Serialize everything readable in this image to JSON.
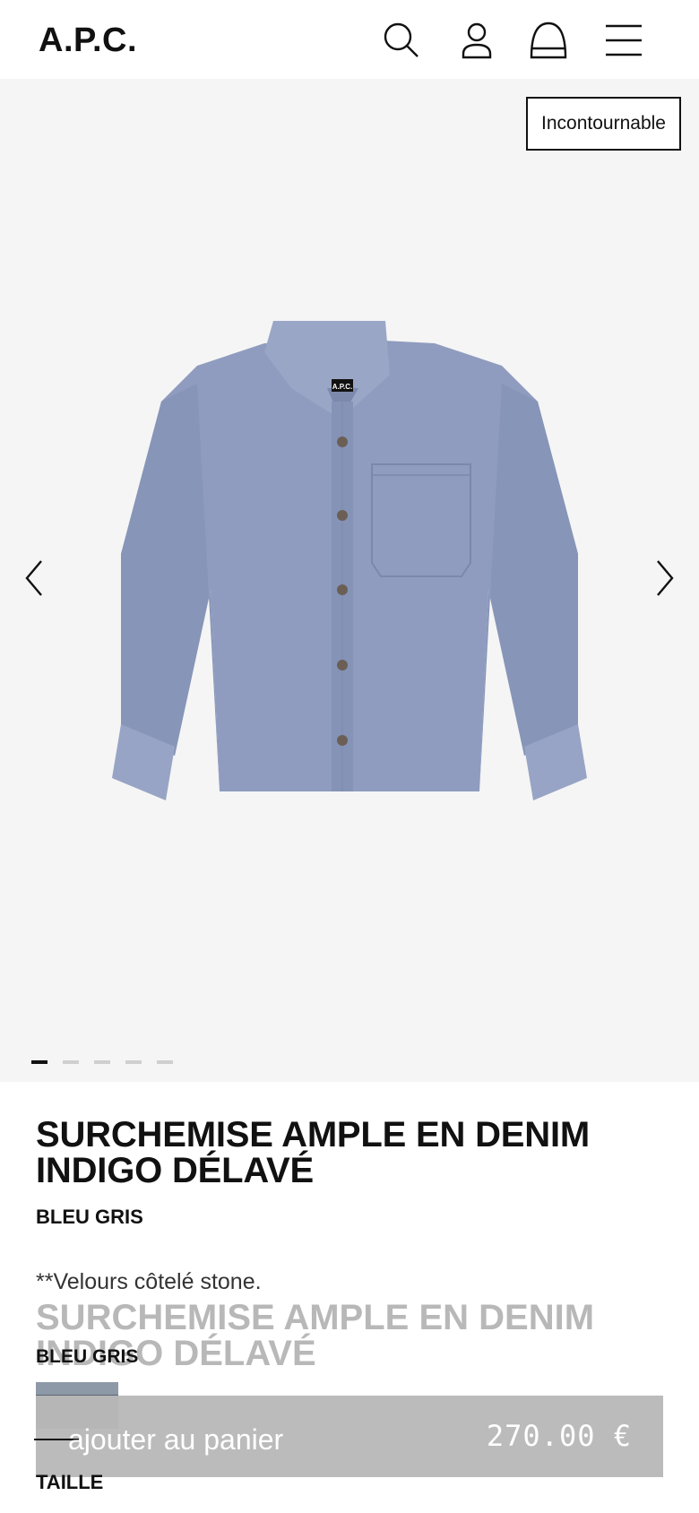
{
  "header": {
    "logo": "A.P.C.",
    "icons": [
      "search-icon",
      "account-icon",
      "bag-icon",
      "menu-icon"
    ]
  },
  "gallery": {
    "badge": "Incontournable",
    "slide_count": 5,
    "active_slide": 1,
    "prev_icon": "chevron-left-icon",
    "next_icon": "chevron-right-icon",
    "image_subject": "shirt-image",
    "image_label": "A.P.C."
  },
  "product": {
    "title": "SURCHEMISE AMPLE EN DENIM INDIGO DÉLAVÉ",
    "color": "BLEU GRIS",
    "description": "**Velours côtelé stone."
  },
  "sticky": {
    "title": "SURCHEMISE AMPLE EN DENIM INDIGO DÉLAVÉ",
    "color": "BLEU GRIS",
    "add_to_cart": "ajouter au panier",
    "price": "270.00 €",
    "size_label": "TAILLE"
  },
  "colors": {
    "background": "#ffffff",
    "gallery_bg": "#f5f5f5",
    "shirt": "#8f9cbf",
    "swatch": "#5d6572",
    "cart_bar": "#b9b9b9"
  }
}
